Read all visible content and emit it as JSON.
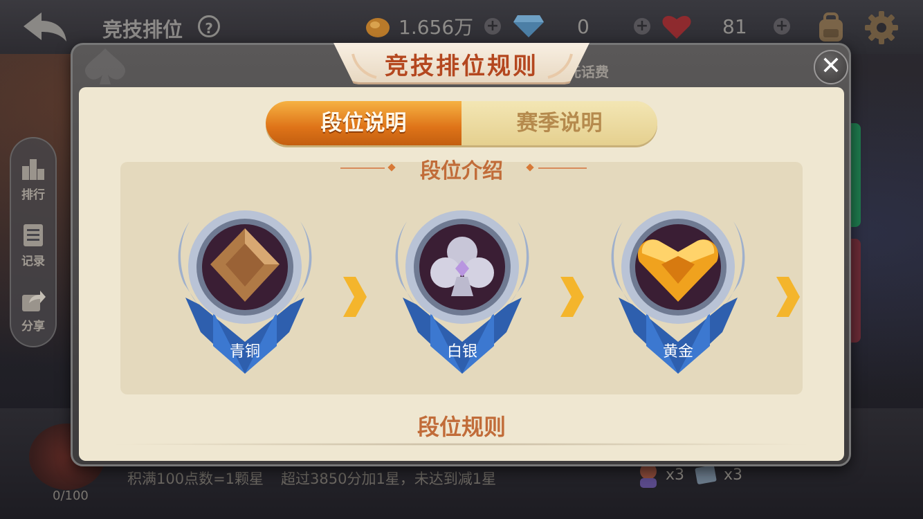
{
  "header": {
    "title": "竞技排位",
    "help_symbol": "?",
    "gold_amount": "1.656万",
    "diamond_amount": "0",
    "hearts_amount": "81",
    "plus_symbol": "+"
  },
  "sidebar": {
    "items": [
      {
        "label": "排行",
        "icon": "ranking-icon"
      },
      {
        "label": "记录",
        "icon": "record-icon"
      },
      {
        "label": "分享",
        "icon": "share-icon"
      }
    ]
  },
  "background": {
    "behind_text": "元话费",
    "rule_line_1": "积满100点数=1颗星",
    "rule_line_2": "超过3850分加1星，未达到减1星",
    "progress": "0/100",
    "reward_1_count": "x3",
    "reward_2_count": "x3"
  },
  "modal": {
    "title": "竞技排位规则",
    "close_symbol": "✕",
    "tabs": [
      {
        "label": "段位说明",
        "active": true
      },
      {
        "label": "赛季说明",
        "active": false
      }
    ],
    "intro_heading": "段位介绍",
    "ranks": [
      {
        "name": "青铜",
        "gem_color": "#b07a46"
      },
      {
        "name": "白银",
        "gem_color": "#c8c6d8"
      },
      {
        "name": "黄金",
        "gem_color": "#f0a21e"
      }
    ],
    "rules_heading": "段位规则"
  },
  "colors": {
    "accent_orange": "#de7318",
    "heading_brown": "#c16c39",
    "panel_cream": "#efe7d1"
  }
}
